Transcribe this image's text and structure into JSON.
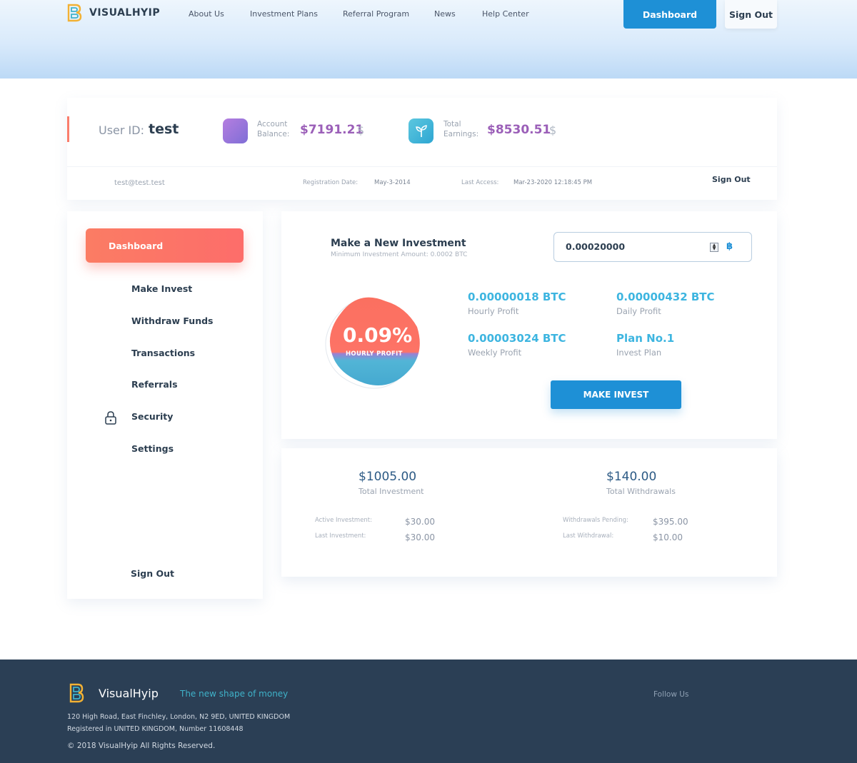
{
  "header": {
    "brand": "VISUALHYIP",
    "nav": [
      "About Us",
      "Investment Plans",
      "Referral Program",
      "News",
      "Help Center"
    ],
    "dashboard_label": "Dashboard",
    "signout_label": "Sign Out"
  },
  "user": {
    "id_label": "User ID:",
    "id_value": "test",
    "balance_label_1": "Account",
    "balance_label_2": "Balance:",
    "balance_value": "$7191.21",
    "balance_currency": "$",
    "earnings_label_1": "Total",
    "earnings_label_2": "Earnings:",
    "earnings_value": "$8530.51",
    "earnings_currency": "$",
    "email": "test@test.test",
    "reg_label": "Registration Date:",
    "reg_value": "May-3-2014",
    "access_label": "Last Access:",
    "access_value": "Mar-23-2020 12:18:45 PM",
    "signout_label": "Sign Out"
  },
  "sidebar": {
    "active": "Dashboard",
    "items": [
      "Make Invest",
      "Withdraw Funds",
      "Transactions",
      "Referrals",
      "Security",
      "Settings"
    ],
    "signout_label": "Sign Out"
  },
  "invest": {
    "title": "Make a New Investment",
    "subtitle": "Minimum Investment Amount: 0.0002 BTC",
    "amount": "0.00020000",
    "currency_symbol": "฿",
    "rate": "0.09%",
    "rate_label": "HOURLY PROFIT",
    "hourly_value": "0.00000018 BTC",
    "hourly_label": "Hourly Profit",
    "daily_value": "0.00000432 BTC",
    "daily_label": "Daily Profit",
    "weekly_value": "0.00003024 BTC",
    "weekly_label": "Weekly Profit",
    "plan_value": "Plan No.1",
    "plan_label": "Invest Plan",
    "button_label": "MAKE INVEST"
  },
  "totals": {
    "investment_value": "$1005.00",
    "investment_label": "Total Investment",
    "active_label": "Active Investment:",
    "active_value": "$30.00",
    "last_inv_label": "Last Investment:",
    "last_inv_value": "$30.00",
    "withdrawals_value": "$140.00",
    "withdrawals_label": "Total Withdrawals",
    "pending_label": "Withdrawals Pending:",
    "pending_value": "$395.00",
    "last_wd_label": "Last Withdrawal:",
    "last_wd_value": "$10.00"
  },
  "footer": {
    "brand": "VisualHyip",
    "tagline": "The new shape of money",
    "follow": "Follow Us",
    "address": "120 High Road, East Finchley, London, N2 9ED, UNITED KINGDOM",
    "registered": "Registered in UNITED KINGDOM, Number 11608448",
    "copyright": "© 2018 VisualHyip All Rights Reserved."
  },
  "colors": {
    "primary_blue": "#1e90d6",
    "accent_coral": "#fb7c64",
    "value_purple": "#9b5fb8",
    "profit_cyan": "#3db5e0",
    "footer_bg": "#2b3f55"
  }
}
